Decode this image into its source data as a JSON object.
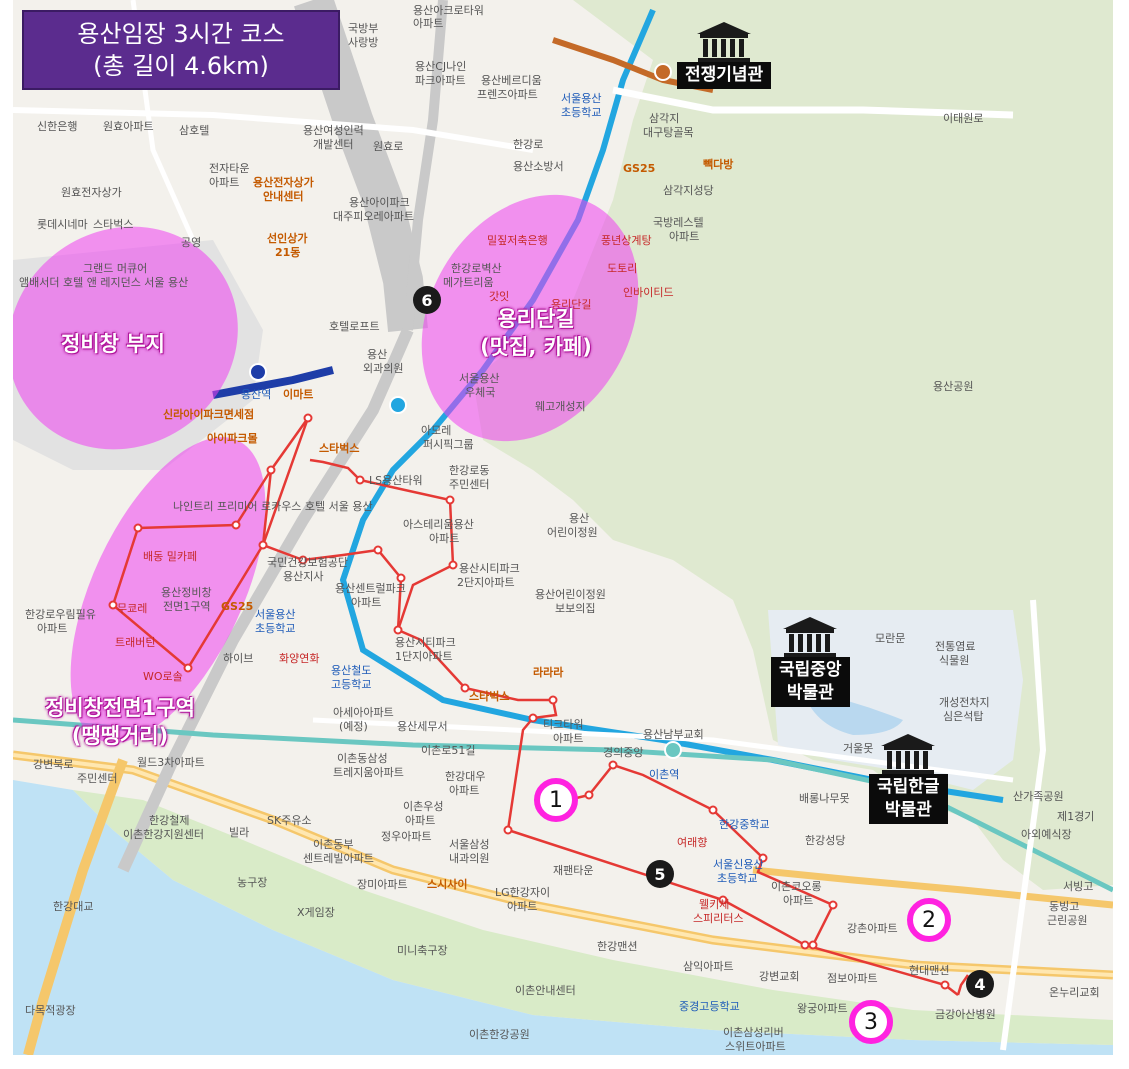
{
  "title": {
    "line1": "용산임장 3시간 코스",
    "line2": "(총 길이 4.6km)"
  },
  "colors": {
    "title_bg": "#5b2c8e",
    "zone_fill": "#ee3ff0",
    "route": "#e53935",
    "marker_ring": "#ff22e0",
    "park": "#dfe9d0",
    "river": "#bfe2f5",
    "rail": "#cfcfcf",
    "subway_line4": "#22a6e0",
    "subway_line1": "#1e3da8",
    "gyeongui": "#6ac7c1"
  },
  "zones": {
    "depot": "정비창 부지",
    "yongridan": {
      "line1": "용리단길",
      "line2": "(맛집, 카페)"
    },
    "redevelop": {
      "line1": "정비창전면1구역",
      "line2": "(땡땡거리)"
    }
  },
  "landmarks": {
    "war_memorial": {
      "name": "전쟁기념관",
      "icon": "museum-building-icon"
    },
    "national_museum": {
      "line1": "국립중앙",
      "line2": "박물관",
      "icon": "museum-building-icon"
    },
    "hangeul_museum": {
      "line1": "국립한글",
      "line2": "박물관",
      "icon": "museum-building-icon"
    }
  },
  "markers": {
    "circled": [
      "1",
      "2",
      "3"
    ],
    "filled": [
      "4",
      "5",
      "6"
    ]
  },
  "poi": {
    "p1": "용산아크로타워",
    "p2": "아파트",
    "p3": "국방부",
    "p4": "사랑방",
    "p5": "신한은행",
    "p6": "원효아파트",
    "p7": "삼호텔",
    "p8": "용산여성인력",
    "p9": "개발센터",
    "p10": "전자타운",
    "p11": "아파트",
    "p12": "용산전자상가",
    "p13": "안내센터",
    "p14": "원효전자상가",
    "p15": "롯데시네마",
    "p16": "스타벅스",
    "p17": "공영",
    "p18": "선인상가",
    "p19": "21동",
    "p20": "그랜드 머큐어",
    "p21": "앰배서더 호텔 앤 레지던스 서울 용산",
    "p22": "용산CJ나인",
    "p23": "파크아파트",
    "p24": "용산베르디움",
    "p25": "프렌즈아파트",
    "p26": "서울용산",
    "p27": "초등학교",
    "p28": "용산소방서",
    "p29": "GS25",
    "p30": "빽다방",
    "p31": "용산아이파크",
    "p32": "대주피오레아파트",
    "p33": "삼각지",
    "p34": "대구탕골목",
    "p35": "삼각지성당",
    "p36": "국방레스텔",
    "p37": "아파트",
    "p38": "밀짚저축은행",
    "p39": "풍년상계탕",
    "p40": "도토리",
    "p41": "인바이티드",
    "p42": "한강로벽산",
    "p43": "메가트리움",
    "p44": "갓잇",
    "p45": "용리단길",
    "p46": "호텔로프트",
    "p47": "용산",
    "p48": "외과의원",
    "p49": "서울용산",
    "p50": "우체국",
    "p51": "웨고개성지",
    "p52": "용산공원",
    "p53": "아모레",
    "p54": "퍼시픽그룹",
    "p55": "이마트",
    "p56": "용산역",
    "p57": "신라아이파크면세점",
    "p58": "아이파크몰",
    "p59": "스타벅스",
    "p60": "LS용산타워",
    "p61": "한강로동",
    "p62": "주민센터",
    "p63": "나인트리 프리미어 로카우스 호텔 서울 용산",
    "p64": "아스테리움용산",
    "p65": "아파트",
    "p66": "용산",
    "p67": "어린이정원",
    "p68": "용산시티파크",
    "p69": "2단지아파트",
    "p70": "용산센트럴파크",
    "p71": "아파트",
    "p72": "국민건강보험공단",
    "p73": "용산지사",
    "p74": "배동 밀카페",
    "p75": "용산정비창",
    "p76": "전면1구역",
    "p77": "GS25",
    "p78": "무쿄레",
    "p79": "트래버틴",
    "p80": "WO로솔",
    "p81": "한강로우림필유",
    "p82": "아파트",
    "p83": "서울용산",
    "p84": "초등학교",
    "p85": "하이브",
    "p86": "화양연화",
    "p87": "용산철도",
    "p88": "고등학교",
    "p89": "용산시티파크",
    "p90": "1단지아파트",
    "p91": "아세아아파트",
    "p92": "(예정)",
    "p93": "용산세무서",
    "p94": "스타벅스",
    "p95": "티크타워",
    "p96": "아파트",
    "p97": "용산남부교회",
    "p98": "용산어린이정원",
    "p99": "보보의집",
    "p100": "모란문",
    "p101": "전통염료",
    "p102": "식물원",
    "p103": "개성전차지",
    "p104": "심은석탑",
    "p105": "거울못",
    "p106": "배롱나무못",
    "p107": "이촌로51길",
    "p108": "이촌동삼성",
    "p109": "트레지움아파트",
    "p110": "한강대우",
    "p111": "아파트",
    "p112": "이촌우성",
    "p113": "아파트",
    "p114": "SK주유소",
    "p115": "정우아파트",
    "p116": "이촌동부",
    "p117": "센트레빌아파트",
    "p118": "장미아파트",
    "p119": "한강철제",
    "p120": "이촌한강지원센터",
    "p121": "빌라",
    "p122": "서울삼성",
    "p123": "내과의원",
    "p124": "스시사이",
    "p125": "LG한강자이",
    "p126": "아파트",
    "p127": "재팬타운",
    "p128": "한강중학교",
    "p129": "여래향",
    "p130": "서울신용산",
    "p131": "초등학교",
    "p132": "한강성당",
    "p133": "이촌코오롱",
    "p134": "아파트",
    "p135": "강촌아파트",
    "p136": "웰키체",
    "p137": "스피리터스",
    "p138": "한강맨션",
    "p139": "삼익아파트",
    "p140": "강변교회",
    "p141": "점보아파트",
    "p142": "현대맨션",
    "p143": "금강아산병원",
    "p144": "왕궁아파트",
    "p145": "중경고등학교",
    "p146": "이촌안내센터",
    "p147": "이촌한강공원",
    "p148": "이촌삼성리버",
    "p149": "스위트아파트",
    "p150": "X게임장",
    "p151": "농구장",
    "p152": "미니축구장",
    "p153": "주민센터",
    "p154": "강변북로",
    "p155": "월드3차아파트",
    "p156": "서빙고",
    "p157": "동빙고",
    "p158": "근린공원",
    "p159": "온누리교회",
    "p160": "제1경기",
    "p161": "아외예식장",
    "p162": "산가족공원",
    "p163": "다목적광장",
    "p164": "한강대교",
    "p165": "이촌역",
    "p166": "경의중앙",
    "p167": "라라라",
    "p168": "이태원로",
    "p169": "원효로",
    "p170": "한강로"
  }
}
